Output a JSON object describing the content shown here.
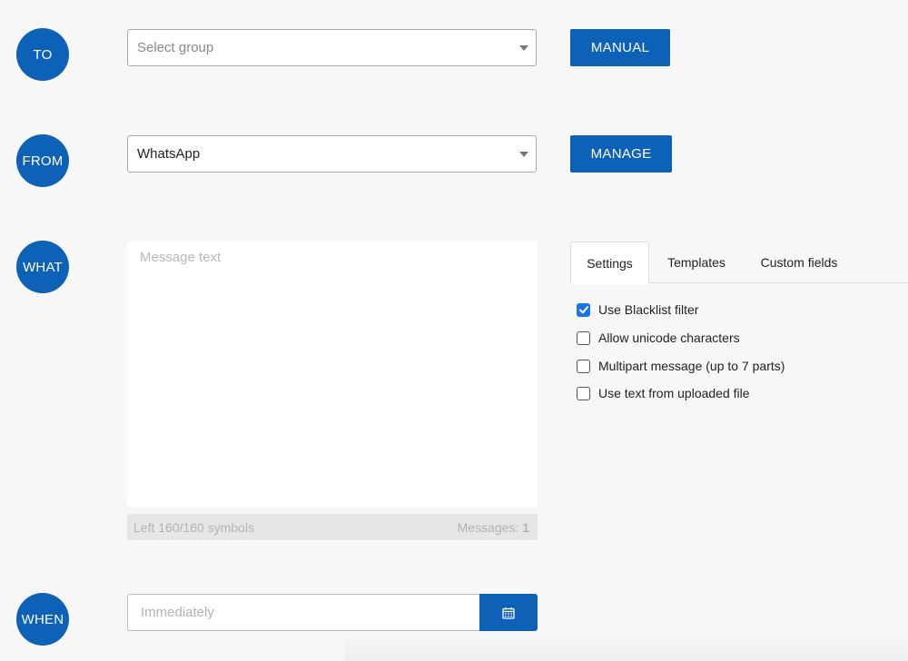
{
  "steps": {
    "to": "TO",
    "from": "FROM",
    "what": "WHAT",
    "when": "WHEN"
  },
  "to_row": {
    "group_select_placeholder": "Select group",
    "manual_button": "MANUAL"
  },
  "from_row": {
    "sender_select_value": "WhatsApp",
    "manage_button": "MANAGE"
  },
  "what_row": {
    "message_placeholder": "Message text",
    "symbols_left": "Left 160/160 symbols",
    "messages_label": "Messages:",
    "messages_count": "1",
    "tabs": [
      {
        "label": "Settings",
        "active": true
      },
      {
        "label": "Templates",
        "active": false
      },
      {
        "label": "Custom fields",
        "active": false
      }
    ],
    "options": [
      {
        "label": "Use Blacklist filter",
        "checked": true
      },
      {
        "label": "Allow unicode characters",
        "checked": false
      },
      {
        "label": "Multipart message (up to 7 parts)",
        "checked": false
      },
      {
        "label": "Use text from uploaded file",
        "checked": false
      }
    ]
  },
  "when_row": {
    "schedule_placeholder": "Immediately",
    "calendar_icon": "calendar-icon"
  },
  "colors": {
    "primary": "#0d62b8",
    "checkbox_checked": "#1a73e8",
    "background": "#f7f7f7"
  }
}
